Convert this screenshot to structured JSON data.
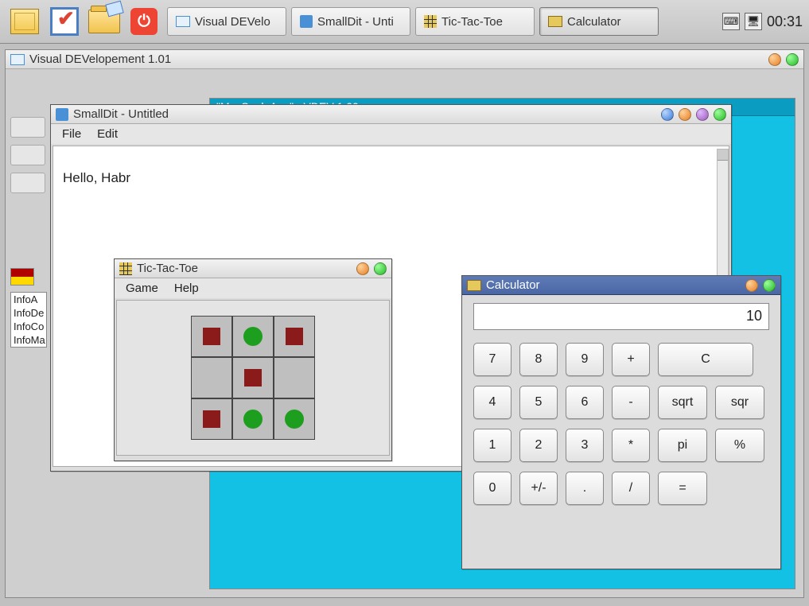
{
  "taskbar": {
    "tasks": [
      {
        "label": "Visual DEVelo",
        "active": false
      },
      {
        "label": "SmallDit - Unti",
        "active": false
      },
      {
        "label": "Tic-Tac-Toe",
        "active": false
      },
      {
        "label": "Calculator",
        "active": true
      }
    ],
    "clock": "00:31"
  },
  "vdev": {
    "title": "Visual DEVelopement 1.01",
    "inner_title": "\"My_Seal_App\" - VDEV 1.00",
    "side_items": [
      "InfoA",
      "InfoDe",
      "InfoCo",
      "InfoMa"
    ]
  },
  "smalldit": {
    "title": "SmallDit - Untitled",
    "menu": [
      "File",
      "Edit"
    ],
    "text": "Hello, Habr"
  },
  "ttt": {
    "title": "Tic-Tac-Toe",
    "menu": [
      "Game",
      "Help"
    ],
    "board": [
      [
        "X",
        "O",
        "X"
      ],
      [
        "",
        "X",
        ""
      ],
      [
        "X",
        "O",
        "O"
      ]
    ]
  },
  "calc": {
    "title": "Calculator",
    "display": "10",
    "rows": [
      [
        "7",
        "8",
        "9",
        "+",
        "C"
      ],
      [
        "4",
        "5",
        "6",
        "-",
        "sqrt",
        "sqr"
      ],
      [
        "1",
        "2",
        "3",
        "*",
        "pi",
        "%"
      ],
      [
        "0",
        "+/-",
        ".",
        "/",
        "="
      ]
    ]
  }
}
